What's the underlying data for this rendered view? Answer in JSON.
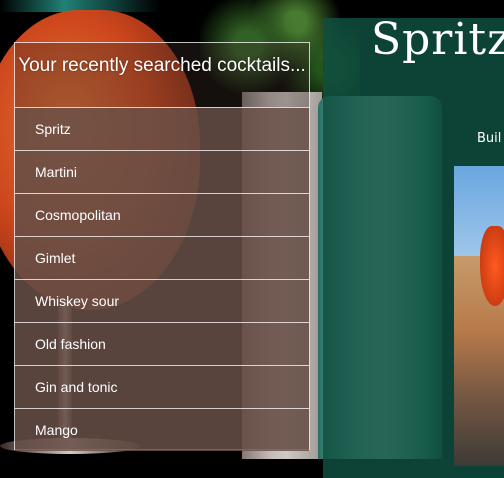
{
  "recent": {
    "title": "Your recently searched cocktails...",
    "items": [
      {
        "label": "Spritz"
      },
      {
        "label": "Martini"
      },
      {
        "label": "Cosmopolitan"
      },
      {
        "label": "Gimlet"
      },
      {
        "label": "Whiskey sour"
      },
      {
        "label": "Old fashion"
      },
      {
        "label": "Gin and tonic"
      },
      {
        "label": "Mango"
      }
    ]
  },
  "detail": {
    "title": "Spritz",
    "subtitle": "Buil"
  },
  "colors": {
    "panel_green": "#0f4f40",
    "item_bg": "#69504a",
    "text": "#ffffff"
  }
}
